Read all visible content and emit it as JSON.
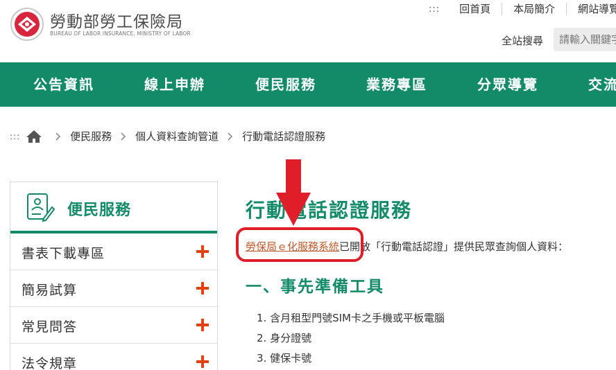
{
  "header": {
    "logo_icon": "bureau-logo-icon",
    "title": "勞動部勞工保險局",
    "subtitle": "BUREAU OF LABOR INSURANCE, MINISTRY OF LABOR"
  },
  "topnav": {
    "dots": ":::",
    "links": [
      "回首頁",
      "本局簡介",
      "網站導覽"
    ]
  },
  "search": {
    "label": "全站搜尋",
    "placeholder": "請輸入關鍵字"
  },
  "mainnav": {
    "items": [
      "公告資訊",
      "線上申辦",
      "便民服務",
      "業務專區",
      "分眾導覽",
      "交流"
    ]
  },
  "breadcrumb": {
    "dots": ":::",
    "home_icon": "home-icon",
    "items": [
      "便民服務",
      "個人資料查詢管道",
      "行動電話認證服務"
    ]
  },
  "sidebar": {
    "icon": "document-edit-icon",
    "title": "便民服務",
    "items": [
      "書表下載專區",
      "簡易試算",
      "常見問答",
      "法令規章"
    ]
  },
  "content": {
    "title": "行動電話認證服務",
    "intro_link": "勞保局ｅ化服務系統",
    "intro_text": "已開放「行動電話認證」提供民眾查詢個人資料：",
    "section_title": "一、事先準備工具",
    "steps": [
      "1. 含月租型門號SIM卡之手機或平板電腦",
      "2. 身分證號",
      "3. 健保卡號"
    ]
  },
  "colors": {
    "brand_green": "#138b68",
    "accent_orange": "#e3420e",
    "annotation_red": "#e01e2a",
    "link_color": "#c0582a"
  }
}
